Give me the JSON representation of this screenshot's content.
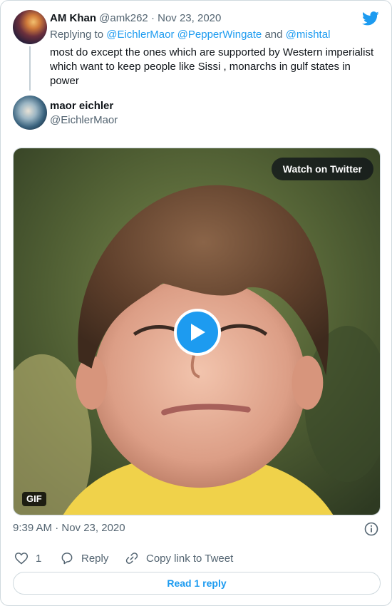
{
  "reply_tweet": {
    "display_name": "AM Khan",
    "handle": "@amk262",
    "separator": "·",
    "date": "Nov 23, 2020",
    "replying_to_prefix": "Replying to",
    "mention_1": "@EichlerMaor",
    "mention_2": "@PepperWingate",
    "and_word": "and",
    "mention_3": "@mishtal",
    "text_line_1": "most do except the ones which are supported by Western imperialist",
    "text_line_2": "which want to keep people like Sissi , monarchs in gulf states in",
    "text_line_3": "power"
  },
  "main_tweet": {
    "display_name": "maor eichler",
    "handle": "@EichlerMaor",
    "media": {
      "watch_label": "Watch on Twitter",
      "gif_label": "GIF"
    },
    "timestamp": "9:39 AM · Nov 23, 2020",
    "likes_count": "1",
    "reply_label": "Reply",
    "copy_link_label": "Copy link to Tweet",
    "read_replies_label": "Read 1 reply"
  },
  "colors": {
    "accent": "#1d9bf0",
    "muted_text": "#536471",
    "border": "#cfd9de"
  },
  "icons": [
    "twitter-bird-icon",
    "play-icon",
    "info-icon",
    "heart-icon",
    "reply-bubble-icon",
    "link-icon"
  ]
}
